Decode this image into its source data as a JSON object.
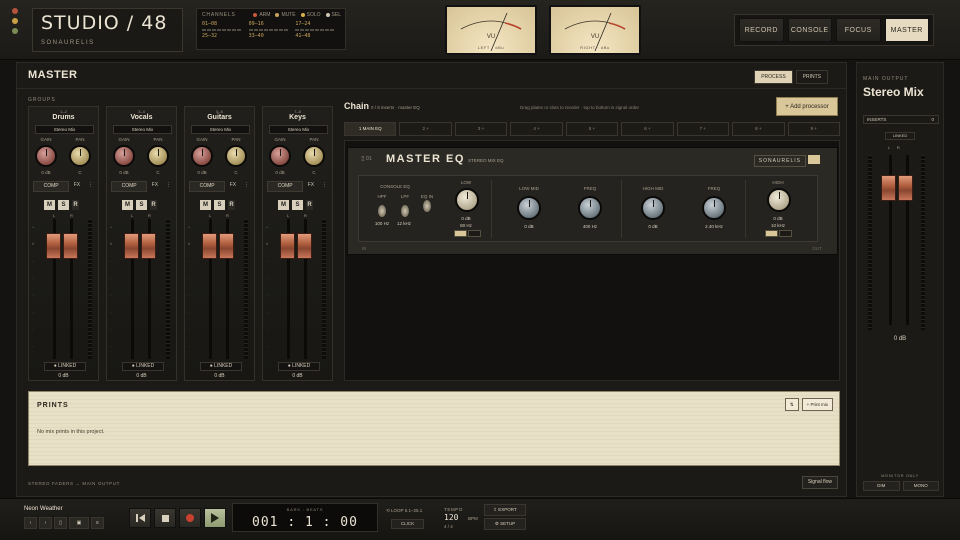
{
  "header": {
    "brand_title": "STUDIO / 48",
    "brand_subtitle": "SONAURELIS",
    "channels_label": "CHANNELS",
    "legend": [
      "ARM",
      "MUTE",
      "SOLO",
      "SEL"
    ],
    "legend_colors": [
      "#c8573d",
      "#c9a45c",
      "#d8b14a",
      "#cfc6b3"
    ],
    "channel_ranges": [
      "01–08",
      "09–16",
      "17–24",
      "25–32",
      "33–40",
      "41–48"
    ],
    "vu_left_label": "VU",
    "vu_left_sub": "LEFT · dBu",
    "vu_right_label": "VU",
    "vu_right_sub": "RIGHT · dBu",
    "modes": [
      "RECORD",
      "CONSOLE",
      "FOCUS",
      "MASTER"
    ],
    "active_mode": "MASTER"
  },
  "master": {
    "title": "MASTER",
    "tabs": [
      "PROCESS",
      "PRINTS"
    ],
    "groups_label": "GROUPS",
    "strips": [
      {
        "range": "1–2",
        "name": "Drums",
        "route": "Stereo Mix",
        "gain_label": "GAIN",
        "pan_label": "PAN",
        "gain_val": "0 dB",
        "pan_val": "C",
        "comp": "COMP",
        "fx": "FX",
        "linked": "LINKED",
        "db": "0 dB"
      },
      {
        "range": "3–4",
        "name": "Vocals",
        "route": "Stereo Mix",
        "gain_label": "GAIN",
        "pan_label": "PAN",
        "gain_val": "0 dB",
        "pan_val": "C",
        "comp": "COMP",
        "fx": "FX",
        "linked": "LINKED",
        "db": "0 dB"
      },
      {
        "range": "5–6",
        "name": "Guitars",
        "route": "Stereo Mix",
        "gain_label": "GAIN",
        "pan_label": "PAN",
        "gain_val": "0 dB",
        "pan_val": "C",
        "comp": "COMP",
        "fx": "FX",
        "linked": "LINKED",
        "db": "0 dB"
      },
      {
        "range": "7–8",
        "name": "Keys",
        "route": "Stereo Mix",
        "gain_label": "GAIN",
        "pan_label": "PAN",
        "gain_val": "0 dB",
        "pan_val": "C",
        "comp": "COMP",
        "fx": "FX",
        "linked": "LINKED",
        "db": "0 dB"
      }
    ],
    "msr": [
      "M",
      "S",
      "R"
    ],
    "chain": {
      "title": "Chain",
      "subtitle": "0 / 8 inserts · master EQ",
      "hint": "Drag plates or slots to reorder · top to bottom is signal order",
      "add_label": "+ Add processor",
      "slots": [
        "1 MAIN EQ",
        "2 +",
        "3 +",
        "4 +",
        "5 +",
        "6 +",
        "7 +",
        "8 +",
        "9 +"
      ]
    },
    "eq": {
      "title": "MASTER EQ",
      "subtitle": "STEREO MIX EQ",
      "brand": "SONAURELIS",
      "section": "CONSOLE EQ",
      "hpf": "HPF",
      "hpf_val": "100 Hz",
      "lpf": "LPF",
      "lpf_val": "12 kHz",
      "eq_in": "EQ IN",
      "bands": [
        {
          "label": "LOW",
          "gain": "0 dB",
          "freq": "80 Hz"
        },
        {
          "label": "LOW MID",
          "gain": "0 dB"
        },
        {
          "label": "FREQ",
          "gain": "400 Hz"
        },
        {
          "label": "HIGH MID",
          "gain": "0 dB"
        },
        {
          "label": "FREQ",
          "gain": "2.40 kHz"
        },
        {
          "label": "HIGH",
          "gain": "0 dB",
          "freq": "10 kHz"
        }
      ],
      "footer_left": "IN",
      "footer_right": "OUT"
    },
    "prints": {
      "title": "PRINTS",
      "empty": "No mix prints in this project.",
      "small_btn": "⇅",
      "print_btn": "+ Print mix"
    },
    "footer": "STEREO FADERS → MAIN OUTPUT",
    "signal_flow": "Signal flow"
  },
  "output": {
    "label": "MAIN OUTPUT",
    "title": "Stereo Mix",
    "inserts": "INSERTS",
    "inserts_count": "0",
    "linked": "LINKED",
    "db": "0 dB",
    "monitor_label": "MONITOR ONLY",
    "monitor_btns": [
      "DIM",
      "MONO"
    ]
  },
  "transport": {
    "project": "Neon Weather",
    "counter_label": "BARS : BEATS",
    "counter": "001 : 1 : 00",
    "loop": "LOOP 5.1–25.1",
    "click": "CLICK",
    "tempo_label": "TEMPO",
    "tempo": "120",
    "bpm": "BPM",
    "sig": "4 / 4",
    "export": "EXPORT",
    "setup": "SETUP"
  }
}
